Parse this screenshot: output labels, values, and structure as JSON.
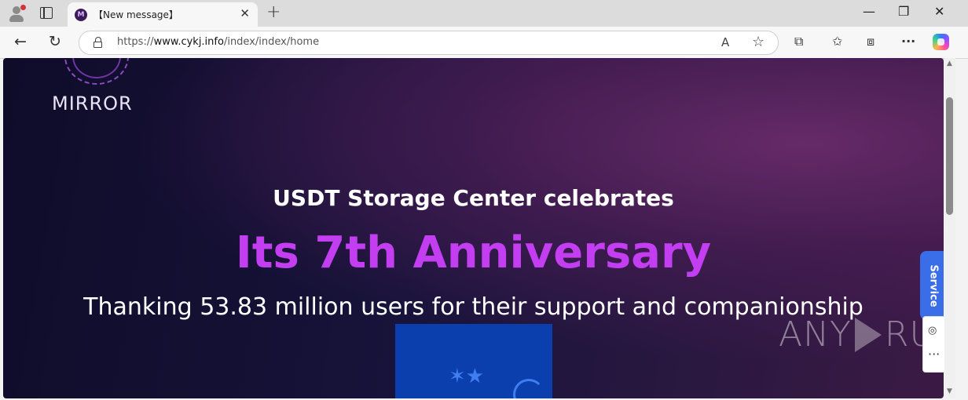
{
  "browser": {
    "tab": {
      "title": "【New message】",
      "favicon_letter": "M"
    },
    "new_tab_symbol": "+",
    "window_controls": {
      "minimize": "—",
      "restore": "❐",
      "close": "✕"
    },
    "address": {
      "prefix": "https://",
      "host": "www.cykj.info",
      "path": "/index/index/home"
    },
    "icons": {
      "back": "←",
      "reload": "↻",
      "read_aloud": "A",
      "favorite": "☆",
      "extensions": "⧉",
      "favorites": "✩",
      "collections": "⧈",
      "more": "···"
    }
  },
  "page": {
    "logo_text": "MIRROR",
    "headline_1": "USDT Storage Center celebrates",
    "headline_2": "Its 7th Anniversary",
    "headline_3": "Thanking 53.83 million users for their support and companionship",
    "service_tab": "Service",
    "watermark": {
      "left": "ANY",
      "right": "RUN"
    },
    "side_panel": {
      "hide_icon": "◎",
      "more": "···"
    }
  },
  "colors": {
    "accent_purple": "#c23ef0",
    "service_blue": "#3a6ee8",
    "promo_blue": "#0b3fae"
  }
}
